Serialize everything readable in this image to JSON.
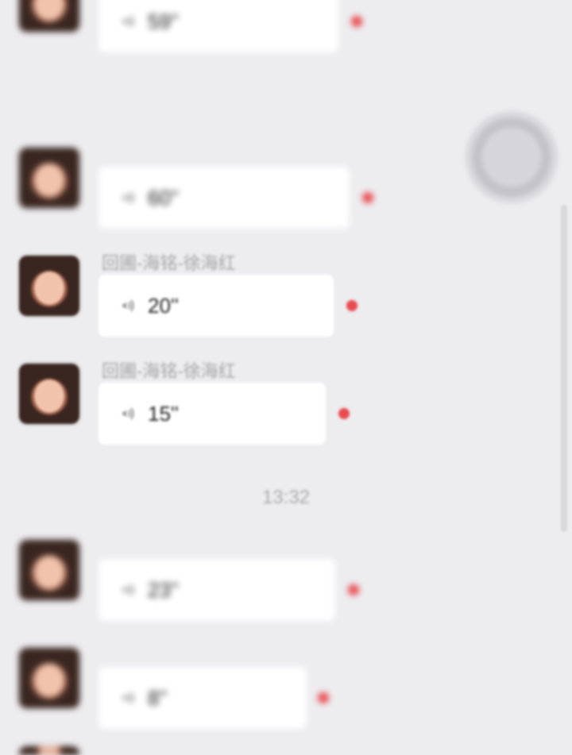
{
  "messages": [
    {
      "sender": "",
      "duration": "59''"
    },
    {
      "sender": "",
      "duration": "60''"
    },
    {
      "sender": "回圃-海铭-徐海红",
      "duration": "20''"
    },
    {
      "sender": "回圃-海铭-徐海红",
      "duration": "15''"
    },
    {
      "sender": "",
      "duration": "23''"
    },
    {
      "sender": "",
      "duration": "8''"
    }
  ],
  "timestamps": [
    "",
    "13:32"
  ],
  "colors": {
    "background": "#edecef",
    "bubble": "#ffffff",
    "unread_dot": "#e84a4f",
    "meta_text": "#a4a4a8"
  },
  "icons": {
    "voice": "speaker-wave-icon",
    "unread": "unread-dot-icon",
    "floating": "floating-action-button"
  }
}
